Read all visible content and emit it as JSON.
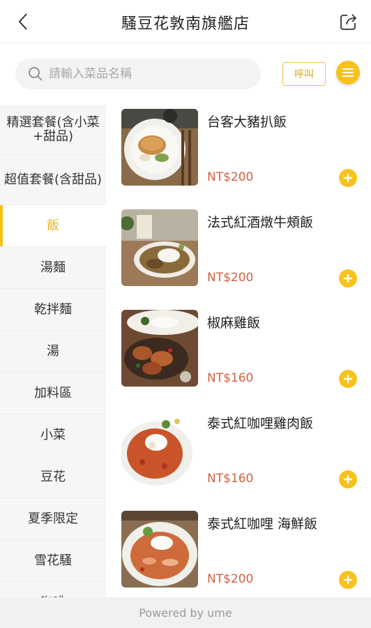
{
  "header": {
    "title": "騷豆花敦南旗艦店",
    "back_icon": "chevron-left-icon",
    "share_icon": "share-icon"
  },
  "search": {
    "placeholder": "請輸入菜品名稱",
    "value": ""
  },
  "actions": {
    "call_label": "呼叫",
    "menu_icon": "hamburger-menu-icon"
  },
  "sidebar": {
    "items": [
      {
        "label": "精選套餐(含小菜+甜品)",
        "active": false
      },
      {
        "label": "超值套餐(含甜品)",
        "active": false
      },
      {
        "label": "飯",
        "active": true
      },
      {
        "label": "湯麵",
        "active": false
      },
      {
        "label": "乾拌麵",
        "active": false
      },
      {
        "label": "湯",
        "active": false
      },
      {
        "label": "加料區",
        "active": false
      },
      {
        "label": "小菜",
        "active": false
      },
      {
        "label": "豆花",
        "active": false
      },
      {
        "label": "夏季限定",
        "active": false
      },
      {
        "label": "雪花騷",
        "active": false
      },
      {
        "label": "咖啡",
        "active": false
      }
    ]
  },
  "menu_items": [
    {
      "name": "台客大豬扒飯",
      "price": "NT$200"
    },
    {
      "name": "法式紅酒燉牛頰飯",
      "price": "NT$200"
    },
    {
      "name": "椒麻雞飯",
      "price": "NT$160"
    },
    {
      "name": "泰式紅咖哩雞肉飯",
      "price": "NT$160"
    },
    {
      "name": "泰式紅咖哩 海鮮飯",
      "price": "NT$200"
    }
  ],
  "footer": {
    "text": "Powered by ume"
  },
  "colors": {
    "accent": "#f7c21e",
    "price": "#d45f3d",
    "active_text": "#f2b21b"
  }
}
